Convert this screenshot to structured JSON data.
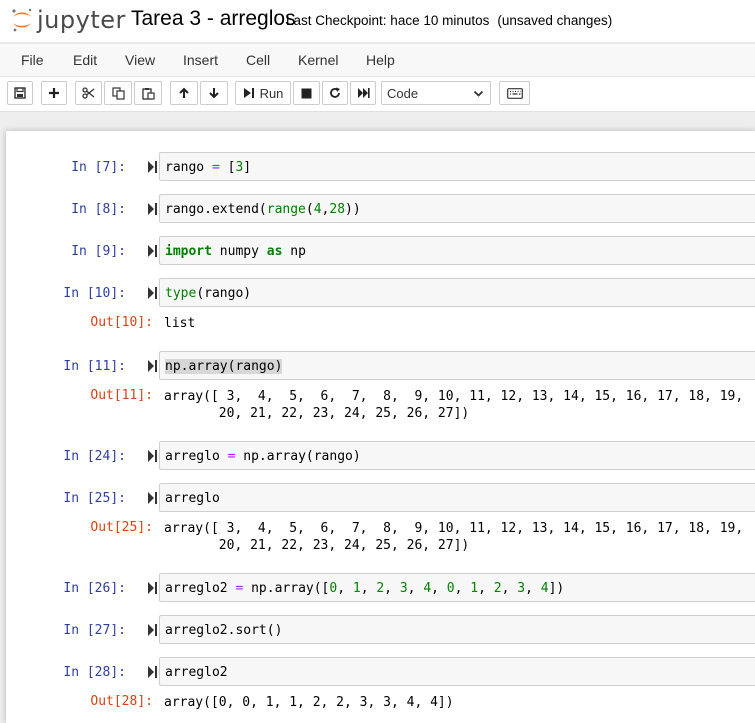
{
  "header": {
    "logo_text": "jupyter",
    "notebook_title": "Tarea 3 - arreglos",
    "checkpoint": "Last Checkpoint: hace 10 minutos",
    "unsaved": "(unsaved changes)"
  },
  "menu": [
    "File",
    "Edit",
    "View",
    "Insert",
    "Cell",
    "Kernel",
    "Help"
  ],
  "toolbar": {
    "run_label": "Run",
    "cell_type": "Code",
    "icons": [
      "save-icon",
      "plus-icon",
      "scissors-icon",
      "copy-icon",
      "paste-icon",
      "arrow-up-icon",
      "arrow-down-icon",
      "play-icon",
      "stop-icon",
      "restart-icon",
      "fast-forward-icon",
      "keyboard-icon"
    ]
  },
  "cells": [
    {
      "prompt": "In [7]:",
      "code": "rango = [3]"
    },
    {
      "prompt": "In [8]:",
      "code": "rango.extend(range(4,28))"
    },
    {
      "prompt": "In [9]:",
      "code": "import numpy as np"
    },
    {
      "prompt": "In [10]:",
      "code": "type(rango)",
      "out_prompt": "Out[10]:",
      "output": "list"
    },
    {
      "prompt": "In [11]:",
      "code": "np.array(rango)",
      "out_prompt": "Out[11]:",
      "output": "array([ 3,  4,  5,  6,  7,  8,  9, 10, 11, 12, 13, 14, 15, 16, 17, 18, 19,\n       20, 21, 22, 23, 24, 25, 26, 27])"
    },
    {
      "prompt": "In [24]:",
      "code": "arreglo = np.array(rango)"
    },
    {
      "prompt": "In [25]:",
      "code": "arreglo",
      "out_prompt": "Out[25]:",
      "output": "array([ 3,  4,  5,  6,  7,  8,  9, 10, 11, 12, 13, 14, 15, 16, 17, 18, 19,\n       20, 21, 22, 23, 24, 25, 26, 27])"
    },
    {
      "prompt": "In [26]:",
      "code": "arreglo2 = np.array([0, 1, 2, 3, 4, 0, 1, 2, 3, 4])"
    },
    {
      "prompt": "In [27]:",
      "code": "arreglo2.sort()"
    },
    {
      "prompt": "In [28]:",
      "code": "arreglo2",
      "out_prompt": "Out[28]:",
      "output": "array([0, 0, 1, 1, 2, 2, 3, 3, 4, 4])"
    }
  ],
  "colors": {
    "in_prompt": "#303f9f",
    "out_prompt": "#d84315",
    "keyword": "#008000",
    "operator": "#aa22ff",
    "logo_orange": "#f37626"
  }
}
